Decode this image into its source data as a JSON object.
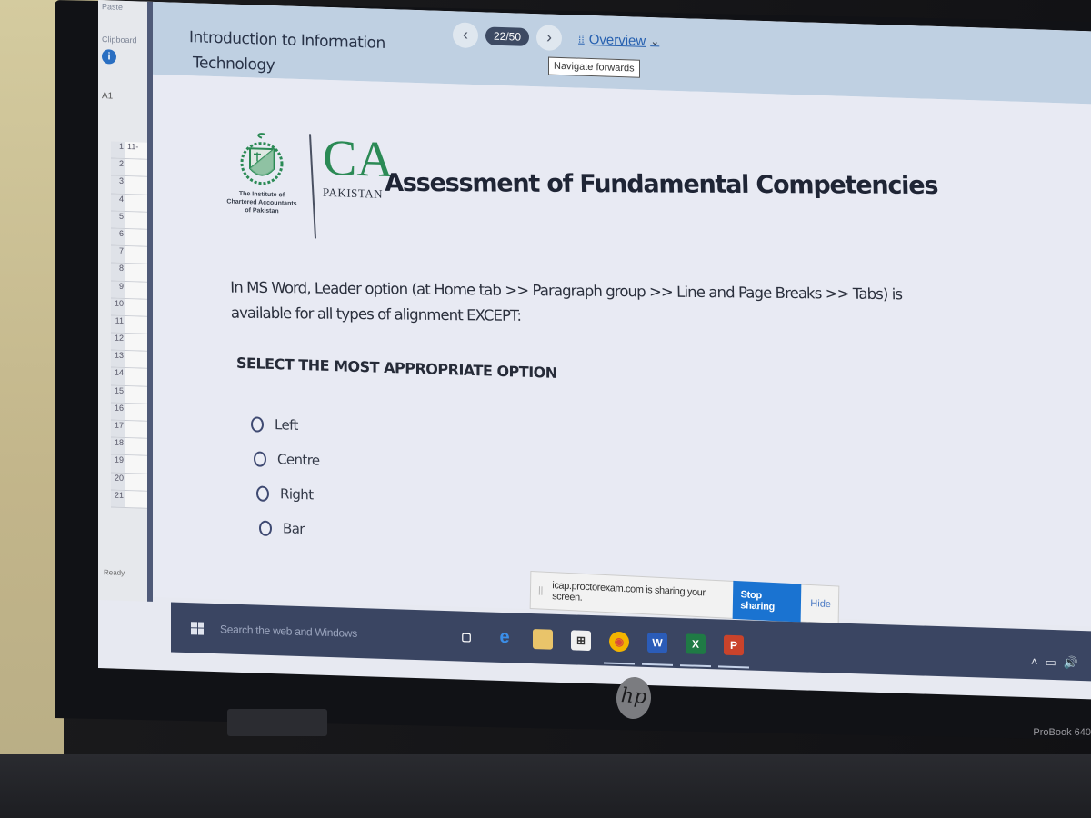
{
  "excel": {
    "ribbon_labels": [
      "Paste",
      "Clipboard"
    ],
    "info_icon": "info-icon",
    "namebox": "A1",
    "first_cell": "11-",
    "row_numbers": [
      "1",
      "2",
      "3",
      "4",
      "5",
      "6",
      "7",
      "8",
      "9",
      "10",
      "11",
      "12",
      "13",
      "14",
      "15",
      "16",
      "17",
      "18",
      "19",
      "20",
      "21"
    ],
    "status": "Ready"
  },
  "exam": {
    "course_title_line1": "Introduction to Information",
    "course_title_line2": "Technology",
    "nav": {
      "prev_icon": "chevron-left-icon",
      "counter": "22/50",
      "next_icon": "chevron-right-icon",
      "overview_label": "Overview",
      "overview_icon": "grid-icon",
      "dropdown_icon": "chevron-down-icon",
      "tooltip": "Navigate forwards"
    },
    "branding": {
      "institute_line1": "The Institute of",
      "institute_line2": "Chartered Accountants",
      "institute_line3": "of Pakistan",
      "ca_text": "CA",
      "pakistan_text": "PAKISTAN",
      "brand_color": "#2b8a55"
    },
    "assessment_title": "Assessment of Fundamental Competencies",
    "question": "In MS Word, Leader option (at Home tab >> Paragraph group >> Line and Page Breaks >> Tabs) is available for all types of alignment EXCEPT:",
    "instruction": "SELECT THE MOST APPROPRIATE OPTION",
    "options": [
      {
        "label": "Left",
        "selected": false
      },
      {
        "label": "Centre",
        "selected": false
      },
      {
        "label": "Right",
        "selected": false
      },
      {
        "label": "Bar",
        "selected": false
      }
    ]
  },
  "share_bar": {
    "message": "icap.proctorexam.com is sharing your screen.",
    "stop_label": "Stop sharing",
    "hide_label": "Hide",
    "accent": "#1a73d1"
  },
  "taskbar": {
    "search_placeholder": "Search the web and Windows",
    "apps": [
      {
        "name": "task-view",
        "glyph": "▢",
        "color": "transparent"
      },
      {
        "name": "edge",
        "glyph": "e",
        "color": "transparent"
      },
      {
        "name": "file-explorer",
        "glyph": "",
        "color": "#e9c46a"
      },
      {
        "name": "store",
        "glyph": "⊞",
        "color": "#f0f0f0"
      },
      {
        "name": "chrome",
        "glyph": "◉",
        "color": "#f3b400"
      },
      {
        "name": "word",
        "glyph": "W",
        "color": "#2b5cb8"
      },
      {
        "name": "excel",
        "glyph": "X",
        "color": "#1f7a45"
      },
      {
        "name": "powerpoint",
        "glyph": "P",
        "color": "#c9432b"
      }
    ],
    "tray": [
      "chevron-up-icon",
      "battery-icon",
      "volume-icon"
    ]
  },
  "device": {
    "brand": "hp",
    "model": "ProBook 640"
  }
}
